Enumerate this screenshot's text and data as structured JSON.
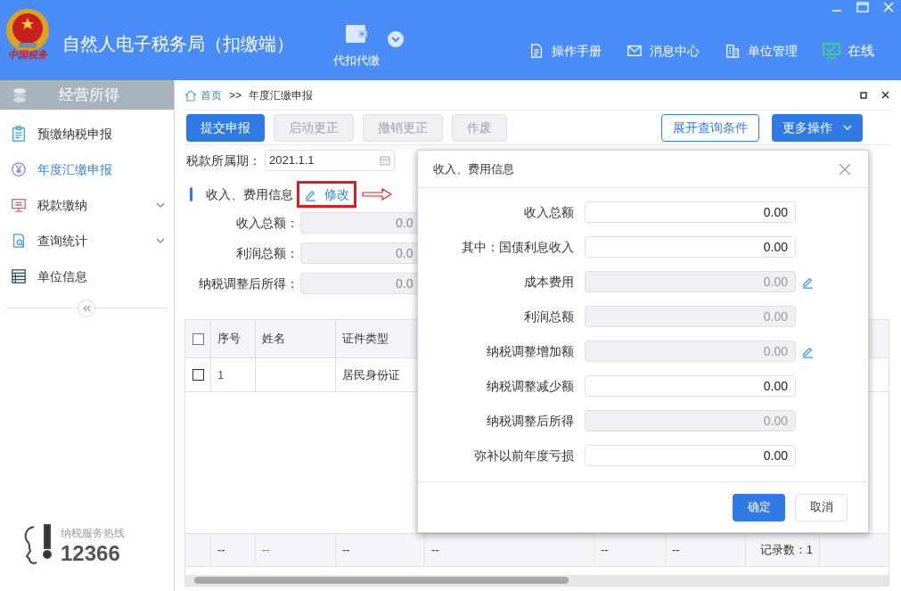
{
  "header": {
    "logo_text": "中国税务",
    "title": "自然人电子税务局（扣缴端）",
    "module": "代扣代缴",
    "links": [
      {
        "label": "操作手册",
        "kind": "manual"
      },
      {
        "label": "消息中心",
        "kind": "message"
      },
      {
        "label": "单位管理",
        "kind": "unit"
      }
    ],
    "status": {
      "label": "在线",
      "online": true
    }
  },
  "sidebar": {
    "title": "经营所得",
    "items": [
      {
        "label": "预缴纳税申报",
        "kind": "clipboard",
        "selected": false,
        "expandable": false
      },
      {
        "label": "年度汇缴申报",
        "kind": "yen",
        "selected": true,
        "expandable": false
      },
      {
        "label": "税款缴纳",
        "kind": "monitor",
        "selected": false,
        "expandable": true
      },
      {
        "label": "查询统计",
        "kind": "search-doc",
        "selected": false,
        "expandable": true
      },
      {
        "label": "单位信息",
        "kind": "list",
        "selected": false,
        "expandable": false
      }
    ],
    "hotline_label": "纳税服务热线",
    "hotline_number": "12366"
  },
  "breadcrumb": {
    "home": "首页",
    "separator": ">>",
    "current": "年度汇缴申报"
  },
  "toolbar": [
    {
      "label": "提交申报",
      "kind": "primary"
    },
    {
      "label": "启动更正",
      "kind": "disabled"
    },
    {
      "label": "撤销更正",
      "kind": "disabled"
    },
    {
      "label": "作废",
      "kind": "disabled"
    }
  ],
  "toolbar_right": [
    {
      "label": "展开查询条件",
      "kind": "outline"
    },
    {
      "label": "更多操作",
      "kind": "dropdown"
    }
  ],
  "period": {
    "label": "税款所属期：",
    "value": "2021.1.1"
  },
  "section": {
    "title": "收入、费用信息",
    "edit_link": "修改",
    "highlighted": true
  },
  "summary_fields": [
    {
      "label": "收入总额：",
      "value": "0.0"
    },
    {
      "label": "利润总额：",
      "value": "0.0"
    },
    {
      "label": "纳税调整后所得：",
      "value": "0.0"
    }
  ],
  "table": {
    "select_all_checked": false,
    "columns": [
      "序号",
      "姓名",
      "证件类型"
    ],
    "rows": [
      {
        "checked": false,
        "cells": [
          "1",
          "",
          "居民身份证"
        ]
      }
    ],
    "footer": [
      "--",
      "--",
      "--",
      "--",
      "--",
      "--",
      "记录数：1"
    ]
  },
  "dialog": {
    "title": "收入、费用信息",
    "fields": [
      {
        "label": "收入总额",
        "value": "0.00",
        "disabled": false,
        "editable_icon": false
      },
      {
        "label": "其中：国债利息收入",
        "value": "0.00",
        "disabled": false,
        "editable_icon": false
      },
      {
        "label": "成本费用",
        "value": "0.00",
        "disabled": true,
        "editable_icon": true
      },
      {
        "label": "利润总额",
        "value": "0.00",
        "disabled": true,
        "editable_icon": false
      },
      {
        "label": "纳税调整增加额",
        "value": "0.00",
        "disabled": true,
        "editable_icon": true
      },
      {
        "label": "纳税调整减少额",
        "value": "0.00",
        "disabled": false,
        "editable_icon": false
      },
      {
        "label": "纳税调整后所得",
        "value": "0.00",
        "disabled": true,
        "editable_icon": false
      },
      {
        "label": "弥补以前年度亏损",
        "value": "0.00",
        "disabled": false,
        "editable_icon": false
      }
    ],
    "buttons": [
      {
        "label": "确定",
        "kind": "primary"
      },
      {
        "label": "取消",
        "kind": "secondary"
      }
    ]
  }
}
